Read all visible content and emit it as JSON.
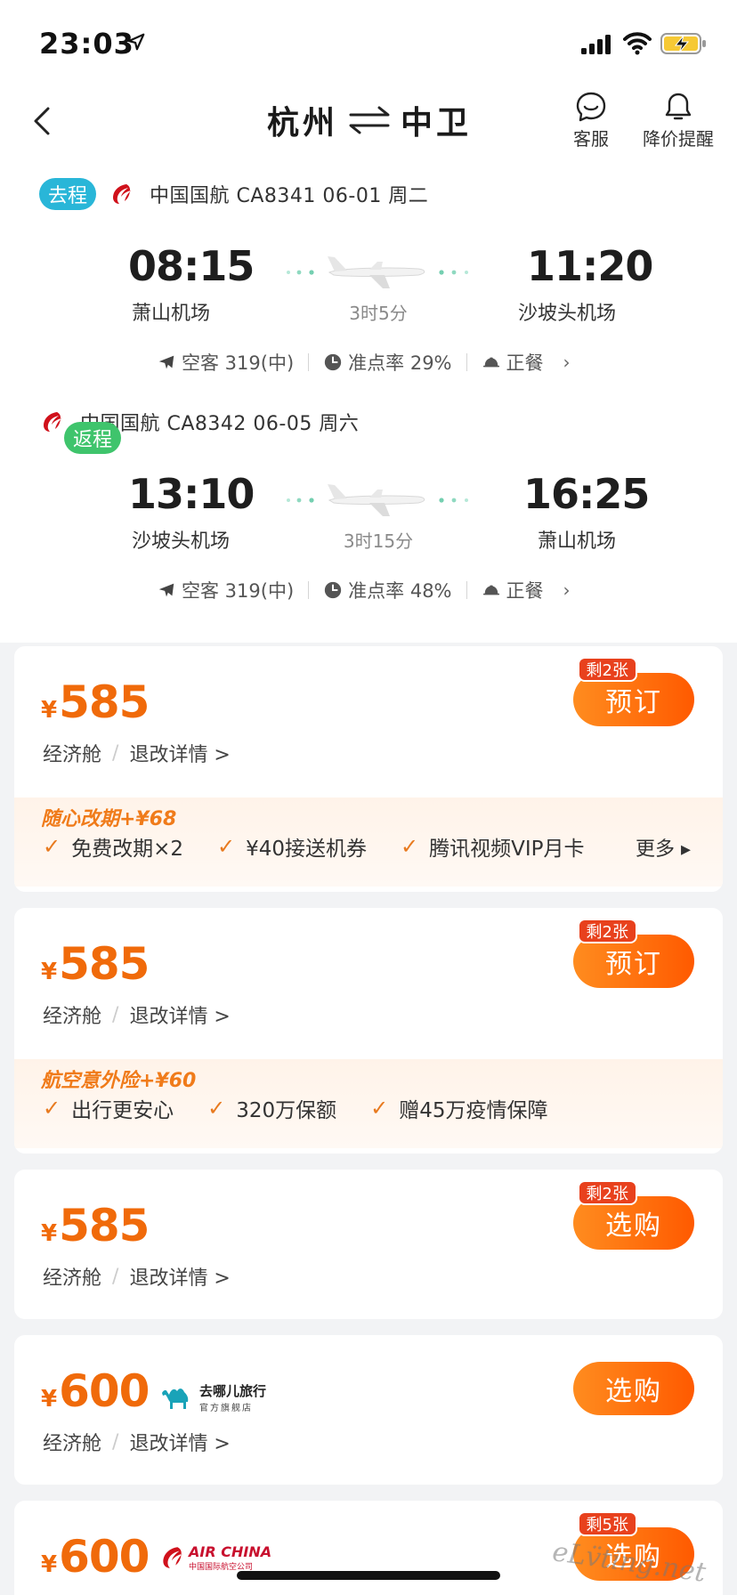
{
  "status_bar": {
    "time": "23:03",
    "icons": [
      "location-arrow-icon",
      "signal-icon",
      "wifi-icon",
      "battery-charging-icon"
    ]
  },
  "header": {
    "from": "杭州",
    "to": "中卫",
    "service_label": "客服",
    "price_alert_label": "降价提醒"
  },
  "outbound": {
    "tag": "去程",
    "info": "中国国航 CA8341  06-01 周二",
    "dep_time": "08:15",
    "dep_airport": "萧山机场",
    "arr_time": "11:20",
    "arr_airport": "沙坡头机场",
    "duration": "3时5分",
    "aircraft": "空客 319(中)",
    "on_time": "准点率 29%",
    "meal": "正餐",
    "chevron": "›"
  },
  "return": {
    "tag": "返程",
    "info": "中国国航 CA8342  06-05 周六",
    "dep_time": "13:10",
    "dep_airport": "沙坡头机场",
    "arr_time": "16:25",
    "arr_airport": "萧山机场",
    "duration": "3时15分",
    "aircraft": "空客 319(中)",
    "on_time": "准点率 48%",
    "meal": "正餐",
    "chevron": "›"
  },
  "offers": [
    {
      "currency": "¥",
      "price": "585",
      "badge": "剩2张",
      "button": "预订",
      "cabin": "经济舱",
      "separator": "/",
      "rules": "退改详情 >",
      "addon": {
        "title": "随心改期+¥68",
        "items": [
          "免费改期×2",
          "¥40接送机券",
          "腾讯视频VIP月卡"
        ],
        "check": "✓",
        "more": "更多 ▸"
      }
    },
    {
      "currency": "¥",
      "price": "585",
      "badge": "剩2张",
      "button": "预订",
      "cabin": "经济舱",
      "separator": "/",
      "rules": "退改详情 >",
      "addon": {
        "title": "航空意外险+¥60",
        "items": [
          "出行更安心",
          "320万保额",
          "赠45万疫情保障"
        ],
        "check": "✓"
      }
    },
    {
      "currency": "¥",
      "price": "585",
      "badge": "剩2张",
      "button": "选购",
      "cabin": "经济舱",
      "separator": "/",
      "rules": "退改详情 >"
    },
    {
      "currency": "¥",
      "price": "600",
      "button": "选购",
      "cabin": "经济舱",
      "separator": "/",
      "rules": "退改详情 >",
      "seller": {
        "name": "去哪儿旅行",
        "sub": "官方旗舰店",
        "icon": "camel-icon"
      }
    },
    {
      "currency": "¥",
      "price": "600",
      "badge": "剩5张",
      "button": "选购",
      "seller": {
        "name": "AIR CHINA",
        "sub": "中国国际航空公司",
        "icon": "air-china-logo"
      }
    }
  ],
  "watermark": "eLv̈ting.net",
  "colors": {
    "accent": "#f06a0a",
    "go_tag": "#29b6d8",
    "return_tag": "#3fc46c",
    "badge": "#e8411d"
  }
}
